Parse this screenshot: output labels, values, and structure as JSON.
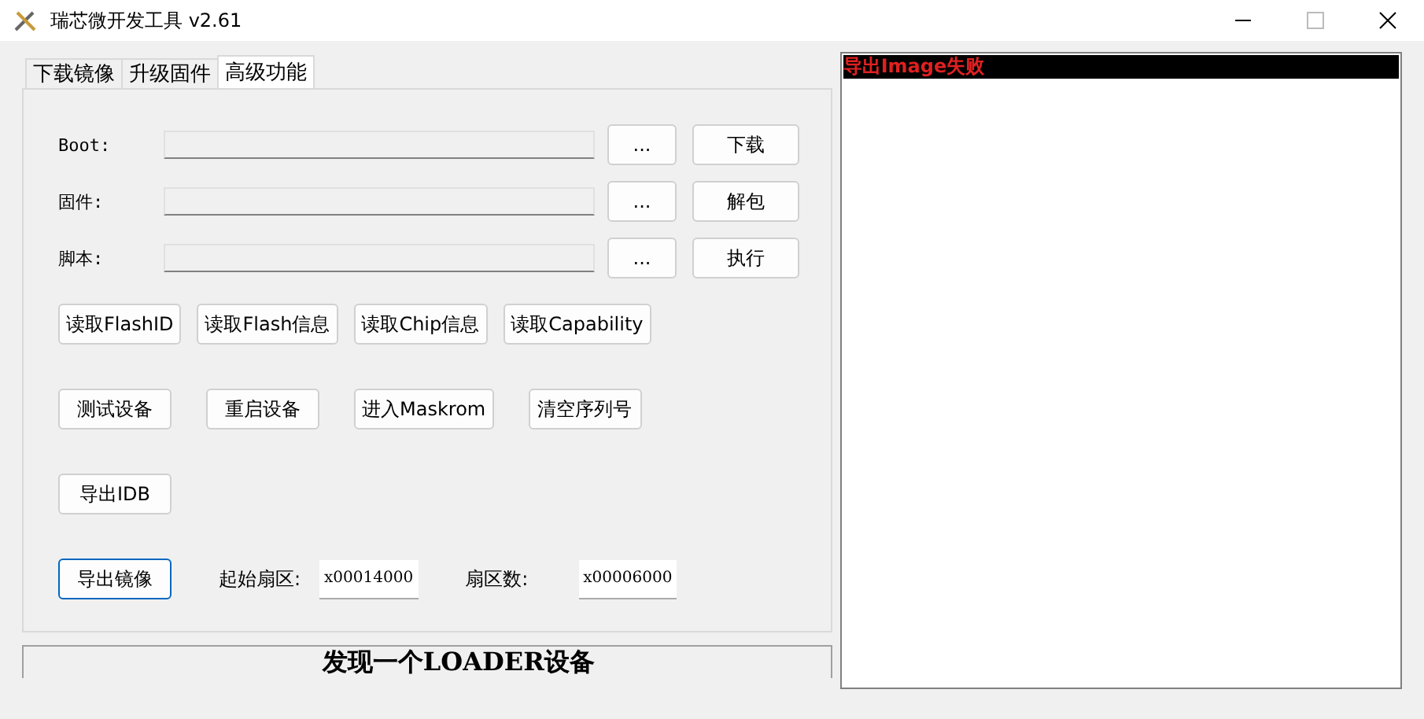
{
  "window": {
    "title": "瑞芯微开发工具 v2.61"
  },
  "tabs": [
    {
      "label": "下载镜像",
      "selected": false
    },
    {
      "label": "升级固件",
      "selected": false
    },
    {
      "label": "高级功能",
      "selected": true
    }
  ],
  "file_rows": [
    {
      "label": "Boot:",
      "browse": "...",
      "action": "下载"
    },
    {
      "label": "固件:",
      "browse": "...",
      "action": "解包"
    },
    {
      "label": "脚本:",
      "browse": "...",
      "action": "执行"
    }
  ],
  "button_rows": [
    [
      {
        "label": "读取FlashID"
      },
      {
        "label": "读取Flash信息"
      },
      {
        "label": "读取Chip信息"
      },
      {
        "label": "读取Capability"
      }
    ],
    [
      {
        "label": "测试设备"
      },
      {
        "label": "重启设备"
      },
      {
        "label": "进入Maskrom"
      },
      {
        "label": "清空序列号"
      }
    ],
    [
      {
        "label": "导出IDB"
      }
    ]
  ],
  "export": {
    "button": "导出镜像",
    "focused": true,
    "start_label": "起始扇区:",
    "start_value": "x00014000",
    "count_label": "扇区数:",
    "count_value": "x00006000"
  },
  "status_bar": "发现一个LOADER设备",
  "log": [
    {
      "text": "导出Image失败",
      "selected": true
    }
  ]
}
